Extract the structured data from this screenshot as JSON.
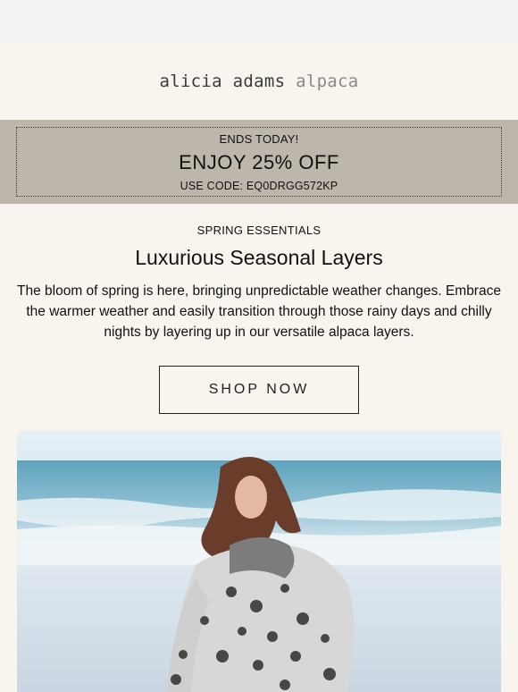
{
  "brand": {
    "logo_main": "alicia adams",
    "logo_secondary": "alpaca"
  },
  "promo": {
    "top": "ENDS TODAY!",
    "main": "ENJOY 25% OFF",
    "code": "USE CODE: EQ0DRGG572KP"
  },
  "content": {
    "eyebrow": "SPRING ESSENTIALS",
    "headline": "Luxurious Seasonal Layers",
    "body": "The bloom of spring is here, bringing unpredictable weather changes. Embrace the warmer weather and easily transition through those rainy days and chilly nights by layering up in our versatile alpaca layers.",
    "cta_label": "SHOP NOW"
  },
  "colors": {
    "background": "#f8f5ef",
    "promo_band": "#bdb6aa",
    "text": "#111111"
  }
}
